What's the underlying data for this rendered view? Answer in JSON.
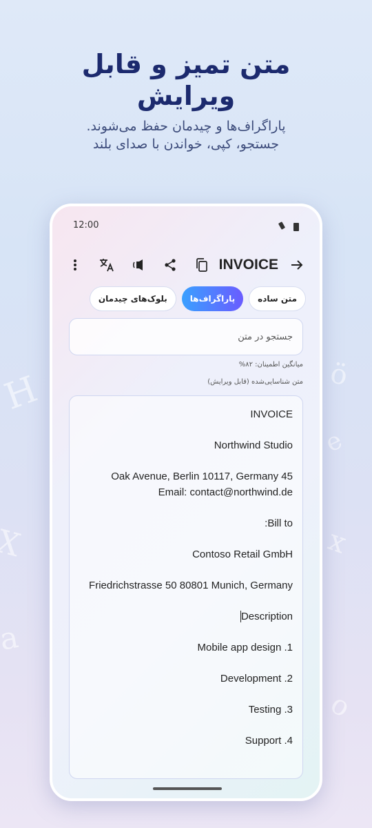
{
  "hero": {
    "title_line1": "متن تمیز و قابل",
    "title_line2": "ویرایش",
    "subtitle_line1": "پاراگراف‌ها و چیدمان حفظ می‌شوند.",
    "subtitle_line2": "جستجو، کپی، خواندن با صدای بلند"
  },
  "status": {
    "time": "12:00"
  },
  "toolbar": {
    "title": "INVOICE",
    "icons": [
      "more-vert-icon",
      "translate-icon",
      "speaker-icon",
      "share-icon",
      "copy-icon",
      "back-arrow-icon"
    ]
  },
  "tabs": [
    {
      "label": "متن ساده",
      "active": false
    },
    {
      "label": "پاراگراف‌ها",
      "active": true
    },
    {
      "label": "بلوک‌های چیدمان",
      "active": false
    }
  ],
  "search": {
    "placeholder": "جستجو در متن"
  },
  "meta": {
    "confidence": "میانگین اطمینان: ۸۲%",
    "recognized_label": "متن شناسایی‌شده (قابل ویرایش)"
  },
  "document": {
    "paragraphs": [
      "INVOICE",
      "Northwind Studio",
      "Oak Avenue, Berlin 10117, Germany 45\nEmail: contact@northwind.de",
      "Bill to:",
      "Contoso Retail GmbH",
      "Friedrichstrasse 50 80801 Munich, Germany",
      "Description",
      "1. Mobile app design",
      "2. Development",
      "3. Testing",
      "4. Support"
    ]
  },
  "colors": {
    "accent_start": "#3aa0ff",
    "accent_end": "#6a5cff",
    "headline": "#1c2a6e"
  }
}
